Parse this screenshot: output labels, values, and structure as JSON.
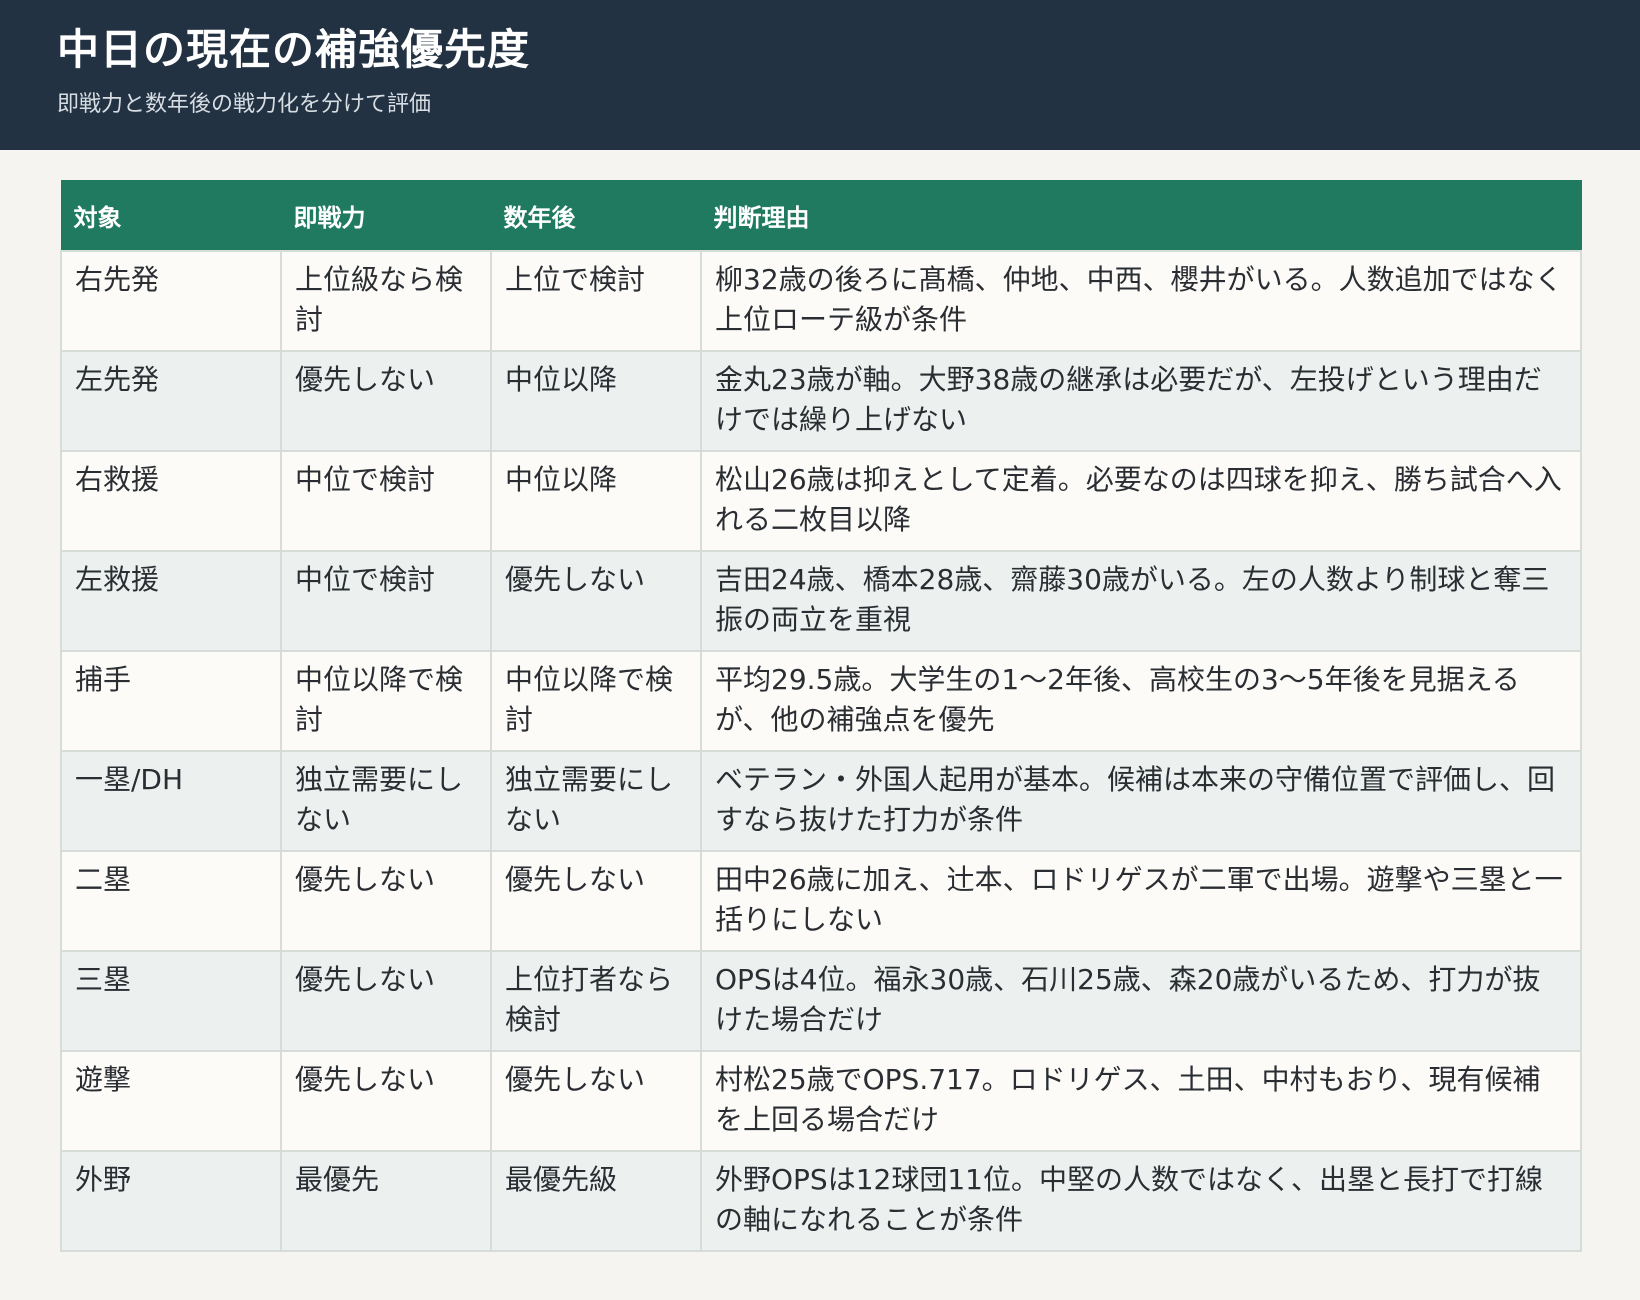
{
  "header": {
    "title": "中日の現在の補強優先度",
    "subtitle": "即戦力と数年後の戦力化を分けて評価"
  },
  "table": {
    "columns": [
      "対象",
      "即戦力",
      "数年後",
      "判断理由"
    ],
    "rows": [
      {
        "target": "右先発",
        "immediate": "上位級なら検討",
        "future": "上位で検討",
        "reason": "柳32歳の後ろに髙橋、仲地、中西、櫻井がいる。人数追加ではなく上位ローテ級が条件"
      },
      {
        "target": "左先発",
        "immediate": "優先しない",
        "future": "中位以降",
        "reason": "金丸23歳が軸。大野38歳の継承は必要だが、左投げという理由だけでは繰り上げない"
      },
      {
        "target": "右救援",
        "immediate": "中位で検討",
        "future": "中位以降",
        "reason": "松山26歳は抑えとして定着。必要なのは四球を抑え、勝ち試合へ入れる二枚目以降"
      },
      {
        "target": "左救援",
        "immediate": "中位で検討",
        "future": "優先しない",
        "reason": "吉田24歳、橋本28歳、齋藤30歳がいる。左の人数より制球と奪三振の両立を重視"
      },
      {
        "target": "捕手",
        "immediate": "中位以降で検討",
        "future": "中位以降で検討",
        "reason": "平均29.5歳。大学生の1〜2年後、高校生の3〜5年後を見据えるが、他の補強点を優先"
      },
      {
        "target": "一塁/DH",
        "immediate": "独立需要にしない",
        "future": "独立需要にしない",
        "reason": "ベテラン・外国人起用が基本。候補は本来の守備位置で評価し、回すなら抜けた打力が条件"
      },
      {
        "target": "二塁",
        "immediate": "優先しない",
        "future": "優先しない",
        "reason": "田中26歳に加え、辻本、ロドリゲスが二軍で出場。遊撃や三塁と一括りにしない"
      },
      {
        "target": "三塁",
        "immediate": "優先しない",
        "future": "上位打者なら検討",
        "reason": "OPSは4位。福永30歳、石川25歳、森20歳がいるため、打力が抜けた場合だけ"
      },
      {
        "target": "遊撃",
        "immediate": "優先しない",
        "future": "優先しない",
        "reason": "村松25歳でOPS.717。ロドリゲス、土田、中村もおり、現有候補を上回る場合だけ"
      },
      {
        "target": "外野",
        "immediate": "最優先",
        "future": "最優先級",
        "reason": "外野OPSは12球団11位。中堅の人数ではなく、出塁と長打で打線の軸になれることが条件"
      }
    ]
  }
}
